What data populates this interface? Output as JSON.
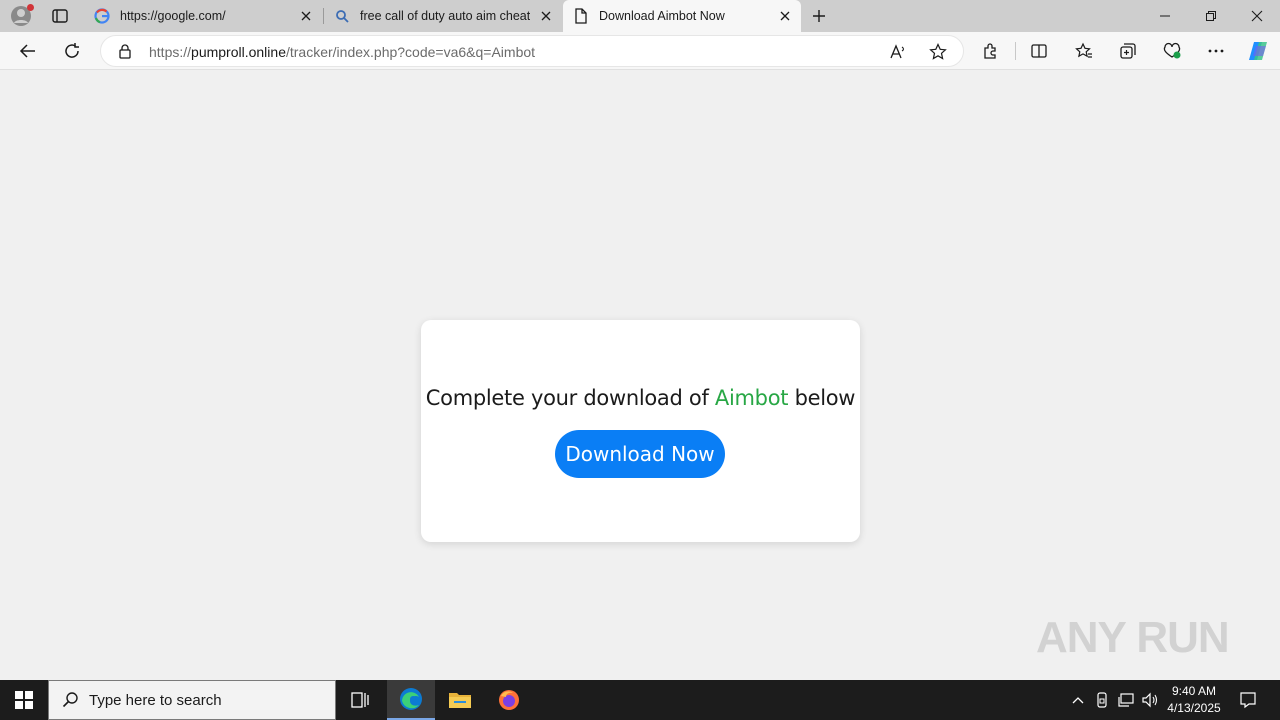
{
  "browser": {
    "tabs": [
      {
        "title": "https://google.com/",
        "favicon": "google-g-icon",
        "active": false
      },
      {
        "title": "free call of duty auto aim cheats",
        "favicon": "search-icon",
        "active": false
      },
      {
        "title": "Download Aimbot Now",
        "favicon": "page-icon",
        "active": true
      }
    ],
    "address": {
      "prefix": "https://",
      "host": "pumproll.online",
      "path": "/tracker/index.php?code=va6&q=Aimbot"
    }
  },
  "page": {
    "message_before": "Complete your download of ",
    "product": "Aimbot",
    "message_after": " below",
    "button_label": "Download Now"
  },
  "watermark": "ANY RUN",
  "taskbar": {
    "search_placeholder": "Type here to search",
    "time": "9:40 AM",
    "date": "4/13/2025"
  },
  "colors": {
    "accent_button": "#0a7ef5",
    "product_text": "#28a745",
    "profile_badge": "#d13438"
  }
}
